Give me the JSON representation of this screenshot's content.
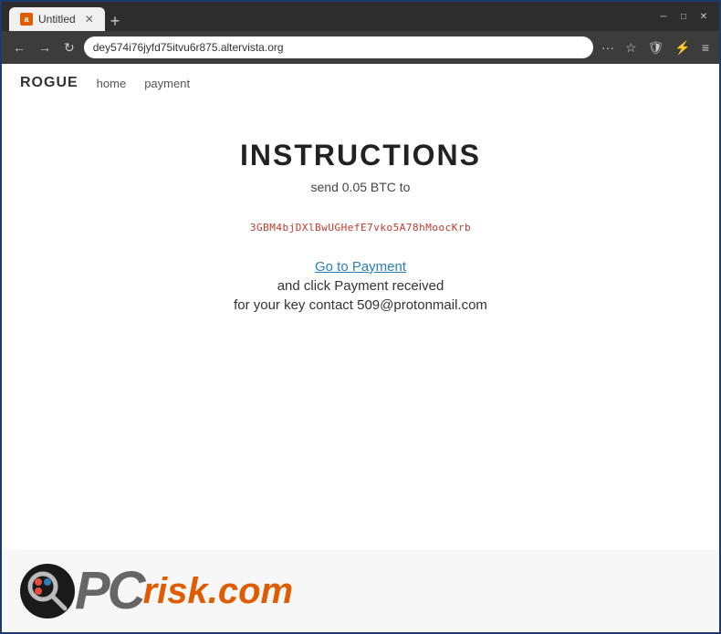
{
  "window": {
    "title": "Untitled",
    "favicon": "a",
    "url": "dey574i76jyfd75itvu6r875.altervista.org"
  },
  "nav": {
    "brand": "ROGUE",
    "links": [
      "home",
      "payment"
    ]
  },
  "main": {
    "title": "INSTRUCTIONS",
    "subtitle": "send 0.05 BTC to",
    "btc_address": "3GBM4bjDXlBwUGHefE7vko5A78hMoocKrb",
    "payment_link": "Go to Payment",
    "payment_text": "and click Payment received",
    "contact_text": "for your key contact 509@protonmail.com"
  },
  "toolbar": {
    "more_label": "···",
    "star_label": "☆",
    "shield_label": "🛡",
    "lightning_label": "⚡",
    "menu_label": "≡"
  },
  "watermark": {
    "site": "PCrisk.com"
  }
}
